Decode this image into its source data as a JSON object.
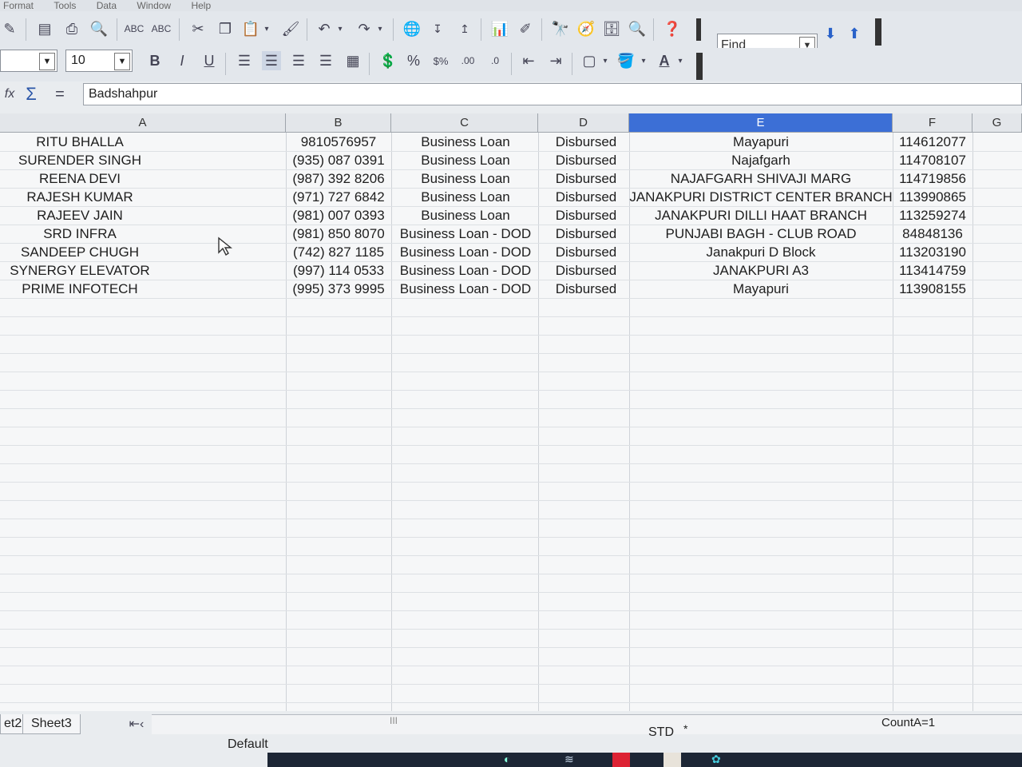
{
  "menu": [
    "Format",
    "Tools",
    "Data",
    "Window",
    "Help"
  ],
  "toolbar": {
    "find_placeholder": "Find",
    "font_size": "10",
    "bold_label": "B",
    "italic_label": "I",
    "underline_label": "U",
    "font_color_label": "A"
  },
  "formula_bar": {
    "fx_label": "fx",
    "sum_label": "Σ",
    "equals_label": "=",
    "content": "Badshahpur"
  },
  "columns": [
    "A",
    "B",
    "C",
    "D",
    "E",
    "F",
    "G"
  ],
  "rows": [
    {
      "a": "RITU BHALLA",
      "b": "9810576957",
      "c": "Business Loan",
      "d": "Disbursed",
      "e": "Mayapuri",
      "f": "114612077"
    },
    {
      "a": "SURENDER SINGH",
      "b": "(935) 087 0391",
      "c": "Business Loan",
      "d": "Disbursed",
      "e": "Najafgarh",
      "f": "114708107"
    },
    {
      "a": "REENA DEVI",
      "b": "(987) 392 8206",
      "c": "Business Loan",
      "d": "Disbursed",
      "e": "NAJAFGARH SHIVAJI MARG",
      "f": "114719856"
    },
    {
      "a": "RAJESH KUMAR",
      "b": "(971) 727 6842",
      "c": "Business Loan",
      "d": "Disbursed",
      "e": "JANAKPURI DISTRICT CENTER BRANCH",
      "f": "113990865"
    },
    {
      "a": "RAJEEV JAIN",
      "b": "(981) 007 0393",
      "c": "Business Loan",
      "d": "Disbursed",
      "e": "JANAKPURI DILLI HAAT BRANCH",
      "f": "113259274"
    },
    {
      "a": "SRD INFRA",
      "b": "(981) 850 8070",
      "c": "Business Loan - DOD",
      "d": "Disbursed",
      "e": "PUNJABI BAGH - CLUB ROAD",
      "f": "84848136"
    },
    {
      "a": "SANDEEP CHUGH",
      "b": "(742) 827 1185",
      "c": "Business Loan - DOD",
      "d": "Disbursed",
      "e": "Janakpuri D Block",
      "f": "113203190"
    },
    {
      "a": "SYNERGY ELEVATOR",
      "b": "(997) 114 0533",
      "c": "Business Loan - DOD",
      "d": "Disbursed",
      "e": "JANAKPURI A3",
      "f": "113414759"
    },
    {
      "a": "PRIME INFOTECH",
      "b": "(995) 373 9995",
      "c": "Business Loan - DOD",
      "d": "Disbursed",
      "e": "Mayapuri",
      "f": "113908155"
    }
  ],
  "status": {
    "sheet_tabs": [
      "et2",
      "Sheet3"
    ],
    "page_style": "Default",
    "mode": "STD",
    "mode_flag": "*",
    "count": "CountA=1",
    "scroll_mark": "III"
  },
  "colors": {
    "selected_header": "#3c6fd6"
  }
}
